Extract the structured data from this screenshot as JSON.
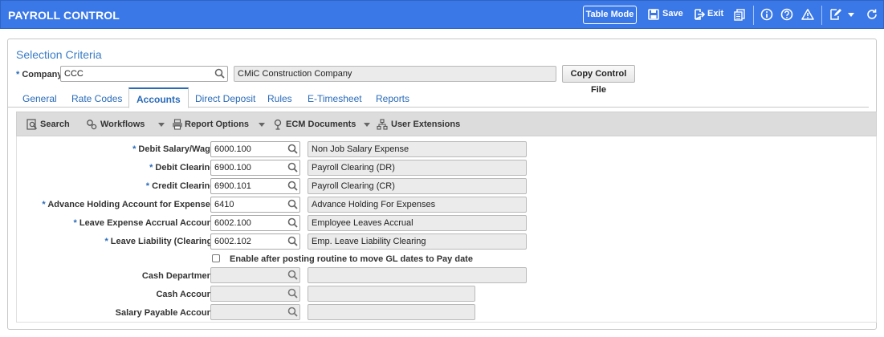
{
  "header": {
    "title": "PAYROLL CONTROL",
    "table_mode": "Table Mode",
    "save": "Save",
    "exit": "Exit",
    "bg_color": "#3b78e7"
  },
  "selection": {
    "title": "Selection Criteria",
    "company_label": "Company",
    "company_value": "CCC",
    "company_name": "CMiC Construction Company",
    "copy_button": "Copy Control File"
  },
  "tabs": [
    {
      "label": "General"
    },
    {
      "label": "Rate Codes"
    },
    {
      "label": "Accounts"
    },
    {
      "label": "Direct Deposit"
    },
    {
      "label": "Rules"
    },
    {
      "label": "E-Timesheet"
    },
    {
      "label": "Reports"
    }
  ],
  "active_tab": "Accounts",
  "toolbar": {
    "search": "Search",
    "workflows": "Workflows",
    "report_options": "Report Options",
    "ecm_documents": "ECM Documents",
    "user_extensions": "User Extensions"
  },
  "fields": [
    {
      "label": "Debit Salary/Wage",
      "required": true,
      "value": "6000.100",
      "desc": "Non Job Salary Expense"
    },
    {
      "label": "Debit Clearing",
      "required": true,
      "value": "6900.100",
      "desc": "Payroll Clearing (DR)"
    },
    {
      "label": "Credit Clearing",
      "required": true,
      "value": "6900.101",
      "desc": "Payroll Clearing (CR)"
    },
    {
      "label": "Advance Holding Account for Expenses",
      "required": true,
      "value": "6410",
      "desc": "Advance Holding For Expenses"
    },
    {
      "label": "Leave Expense Accrual Account",
      "required": true,
      "value": "6002.100",
      "desc": "Employee Leaves Accrual"
    },
    {
      "label": "Leave Liability (Clearing)",
      "required": true,
      "value": "6002.102",
      "desc": "Emp. Leave Liability Clearing"
    }
  ],
  "checkbox": {
    "label": "Enable after posting routine to move GL dates to Pay date",
    "checked": false
  },
  "optional_fields": [
    {
      "label": "Cash Department",
      "value": "",
      "desc": ""
    },
    {
      "label": "Cash Account",
      "value": "",
      "desc": ""
    },
    {
      "label": "Salary Payable Account",
      "value": "",
      "desc": ""
    }
  ]
}
